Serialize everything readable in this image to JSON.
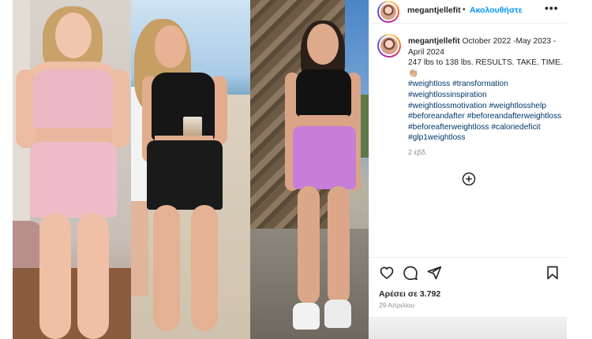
{
  "post": {
    "username": "megantjellefit",
    "separator": "•",
    "follow_label": "Ακολουθήστε",
    "more_options": "•••",
    "caption": {
      "username": "megantjellefit",
      "text_line1": " October 2022 -May 2023 -April 2024",
      "text_line2": "247 lbs to 138 lbs. RESULTS. TAKE. TIME. 👏🏼",
      "hashtags": [
        "#weightloss",
        "#transformation",
        "#weightlossinspiration",
        "#weightlossmotivation",
        "#weightlosshelp",
        "#beforeandafter",
        "#beforeandafterweightloss",
        "#beforeafterweightloss",
        "#caloriedeficit",
        "#glp1weightloss"
      ],
      "time_ago": "2 εβδ."
    },
    "likes_text": "Αρέσει σε 3.792",
    "date_text": "29 Απριλίου"
  },
  "icons": {
    "like": "heart-outline-icon",
    "comment": "comment-bubble-icon",
    "share": "paper-plane-icon",
    "save": "bookmark-icon",
    "more_comments": "plus-circle-icon",
    "options": "ellipsis-icon"
  },
  "colors": {
    "follow": "#0095f6",
    "hashtag": "#00376b",
    "secondary_text": "#8e8e8e",
    "divider": "#efefef"
  }
}
